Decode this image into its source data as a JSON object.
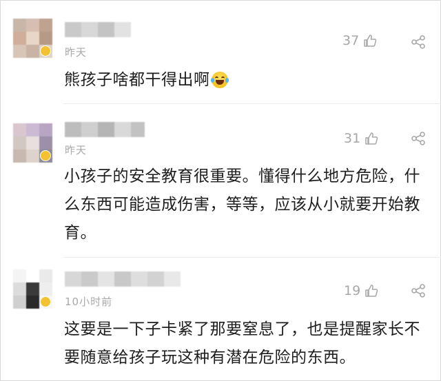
{
  "comments": [
    {
      "time": "昨天",
      "likes": "37",
      "text": "熊孩子啥都干得出啊",
      "emoji": "laugh-cry-emoji",
      "avatar_colors": [
        "#c8b7a8",
        "#d6bfb2",
        "#bfa390",
        "#cfae9c",
        "#e8d6c8",
        "#b69a88",
        "#d7c5b8",
        "#c9b3a5",
        "#e0d2c6"
      ],
      "name_colors": [
        "#c9c9c9",
        "#d8d8d8",
        "#c4c4c4",
        "#e2e2e2"
      ]
    },
    {
      "time": "昨天",
      "likes": "31",
      "text": "小孩子的安全教育很重要。懂得什么地方危险，什么东西可能造成伤害，等等，应该从小就要开始教育。",
      "avatar_colors": [
        "#d9c6cf",
        "#ccb9d4",
        "#b8a5c4",
        "#d2c8c3",
        "#e8e0de",
        "#9c8fa8",
        "#c7b8b0",
        "#ddd2cc",
        "#8c8a96"
      ],
      "name_colors": [
        "#bdbdbd",
        "#cfcfcf",
        "#b5b5b5",
        "#d9d9d9",
        "#c2c2c2"
      ]
    },
    {
      "time": "10小时前",
      "likes": "19",
      "text": "这要是一下子卡紧了那要窒息了，也是提醒家长不要随意给孩子玩这种有潜在危险的东西。",
      "avatar_colors": [
        "#f4f4f4",
        "#ffffff",
        "#eaeaea",
        "#dcdcdc",
        "#3a3a3a",
        "#eeeeee",
        "#d0d0d0",
        "#2a2a2a",
        "#f6f6f6"
      ],
      "name_colors": [
        "#d7d7d7",
        "#cacaca",
        "#e4e4e4",
        "#c8c8c8",
        "#dedede",
        "#d2d2d2",
        "#e8e8e8"
      ]
    }
  ],
  "colors": {
    "text": "#1e1e1e",
    "meta": "#a9a9a9",
    "divider": "#ececec",
    "vip_badge": "#f2c230"
  },
  "icons": {
    "like": "thumbs-up-icon",
    "share": "share-icon"
  }
}
